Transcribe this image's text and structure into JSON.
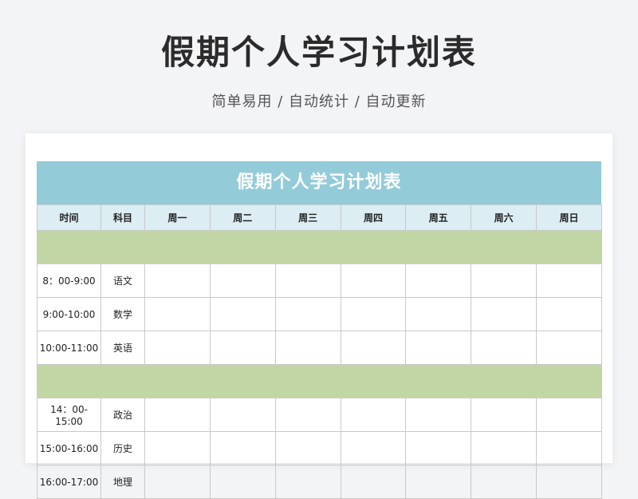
{
  "page": {
    "title": "假期个人学习计划表",
    "subtitle": "简单易用 / 自动统计 / 自动更新"
  },
  "sheet": {
    "title": "假期个人学习计划表",
    "columns": [
      "时间",
      "科目",
      "周一",
      "周二",
      "周三",
      "周四",
      "周五",
      "周六",
      "周日"
    ],
    "rows": [
      {
        "time": "8：00-9:00",
        "subject": "语文"
      },
      {
        "time": "9:00-10:00",
        "subject": "数学"
      },
      {
        "time": "10:00-11:00",
        "subject": "英语"
      },
      {
        "time": "14：00-15:00",
        "subject": "政治"
      },
      {
        "time": "15:00-16:00",
        "subject": "历史"
      },
      {
        "time": "16:00-17:00",
        "subject": "地理"
      }
    ]
  },
  "colors": {
    "header_bg": "#93cbd9",
    "column_header_bg": "#dcedf3",
    "separator": "#c2d6a5"
  }
}
